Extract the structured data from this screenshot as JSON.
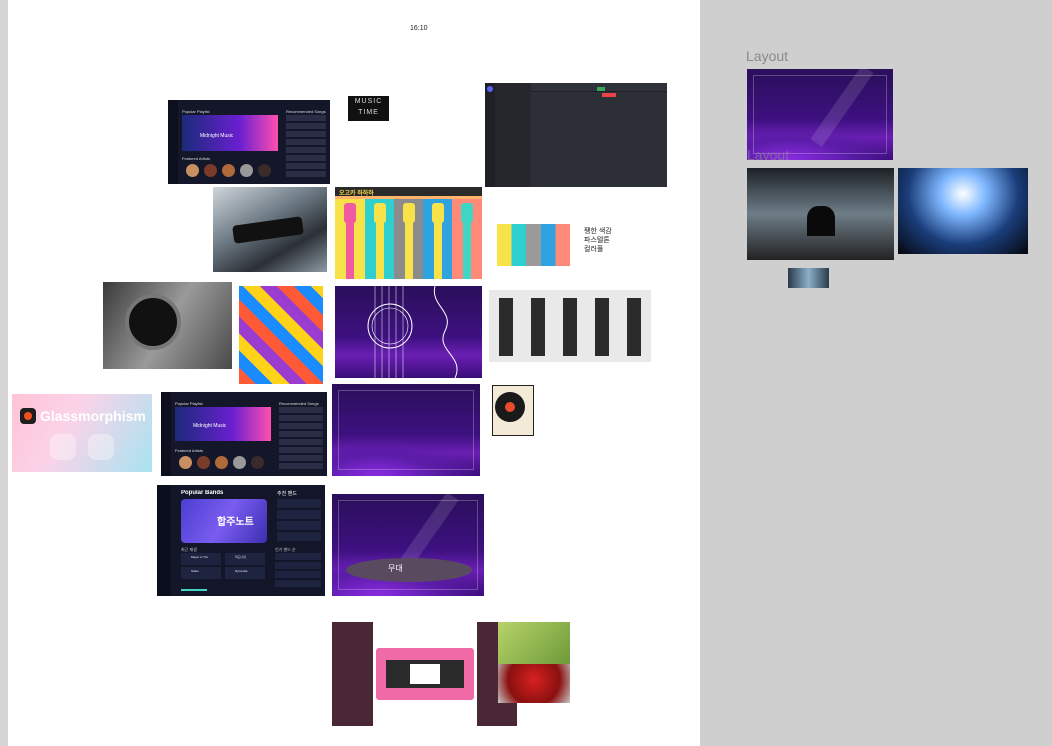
{
  "canvas": {
    "ratio_label": "16:10"
  },
  "side_panel": {
    "layout_label": "Layout",
    "layout_label_ghost": "Layout"
  },
  "music_logo": {
    "line1": "MUSIC",
    "line2": "TIME"
  },
  "player_app": {
    "section_title": "Popular Playlist",
    "hero_title": "Midnight Music",
    "recommended_title": "Recommended Songs",
    "artists_title": "Featured Artists"
  },
  "banner": {
    "text": "오고카 하하하"
  },
  "pastel_note": {
    "line1": "쨍한 색감",
    "line2": "파스텔톤",
    "line3": "컬러풀"
  },
  "glass_card": {
    "title": "Glassmorphism"
  },
  "korean_app": {
    "popular_title": "Popular Bands",
    "hero_text": "합주노트",
    "recommended_title": "추천 밴드",
    "recent_title": "최근 재생",
    "rank_title": "인기 밴드 순",
    "tracks": [
      "Mayer is Tho",
      "Stoke",
      "미드나잇",
      "Dynamite"
    ]
  },
  "stage": {
    "label": "무대"
  },
  "colors": {
    "stage_purple": "#3d1080",
    "accent_violet": "#8a2be2",
    "vhs_pink": "#f06aa8",
    "plum": "#4a2734"
  }
}
